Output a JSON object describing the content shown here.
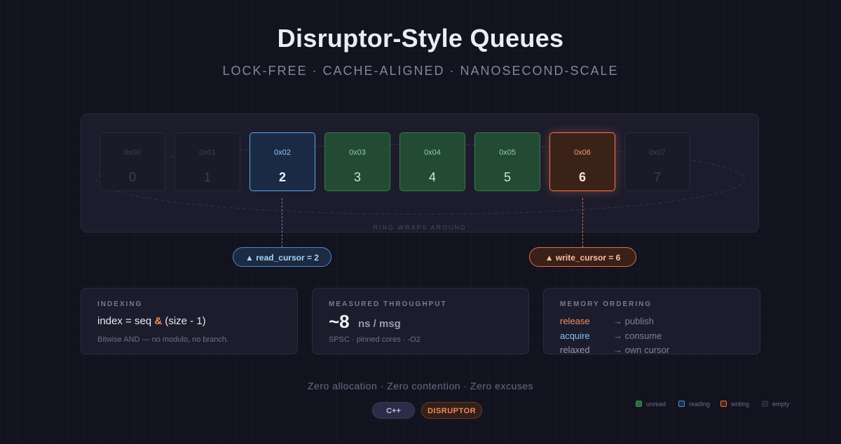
{
  "header": {
    "title": "Disruptor-Style Queues",
    "subtitle": "LOCK-FREE · CACHE-ALIGNED · NANOSECOND-SCALE"
  },
  "ring": {
    "label": "RING WRAPS AROUND",
    "slots": [
      {
        "addr": "0x00",
        "index": "0",
        "state": "empty"
      },
      {
        "addr": "0x01",
        "index": "1",
        "state": "empty"
      },
      {
        "addr": "0x02",
        "index": "2",
        "state": "reading"
      },
      {
        "addr": "0x03",
        "index": "3",
        "state": "unread"
      },
      {
        "addr": "0x04",
        "index": "4",
        "state": "unread"
      },
      {
        "addr": "0x05",
        "index": "5",
        "state": "unread"
      },
      {
        "addr": "0x06",
        "index": "6",
        "state": "writing"
      },
      {
        "addr": "0x07",
        "index": "7",
        "state": "empty"
      }
    ]
  },
  "cursors": {
    "read": {
      "label": "▲ read_cursor = 2",
      "slot": 2
    },
    "write": {
      "label": "▲ write_cursor = 6",
      "slot": 6
    }
  },
  "cards": {
    "indexing": {
      "label": "INDEXING",
      "formula_left": "index = seq",
      "formula_op": "&",
      "formula_right": "(size - 1)",
      "note": "Bitwise AND — no modulo, no branch."
    },
    "throughput": {
      "label": "MEASURED THROUGHPUT",
      "value": "~8",
      "unit": "ns / msg",
      "note": "SPSC · pinned cores · -O2"
    },
    "ordering": {
      "label": "MEMORY ORDERING",
      "rows": [
        {
          "name": "release",
          "desc": "→ publish",
          "color": "#f0905e"
        },
        {
          "name": "acquire",
          "desc": "→ consume",
          "color": "#7ec8f0"
        },
        {
          "name": "relaxed",
          "desc": "→ own cursor",
          "color": "#9a9ab2"
        }
      ]
    }
  },
  "footer": {
    "tagline": "Zero allocation · Zero contention · Zero excuses",
    "badges": {
      "cpp": "C++",
      "disruptor": "DISRUPTOR"
    }
  },
  "legend": [
    {
      "label": "unread",
      "color": "#2f6a42",
      "border": "#3c8a52"
    },
    {
      "label": "reading",
      "color": "#1c2e4a",
      "border": "#4a8cd0"
    },
    {
      "label": "writing",
      "color": "#4a2418",
      "border": "#e0704c"
    },
    {
      "label": "empty",
      "color": "#242438",
      "border": "#34344a"
    }
  ],
  "colors": {
    "accent_write": "#f07850",
    "accent_read": "#5aa8e8",
    "unread": "#3c7a50",
    "background": "#13131f"
  }
}
